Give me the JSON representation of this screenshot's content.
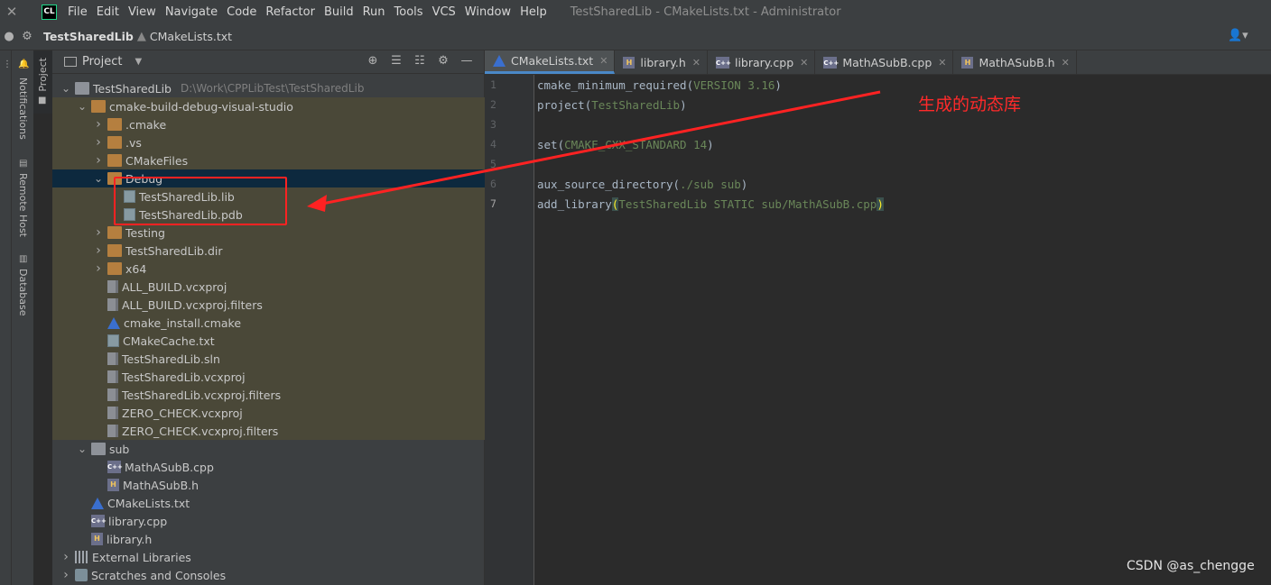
{
  "menubar": {
    "close_glyph": "✕",
    "logo": "CL",
    "items": [
      "File",
      "Edit",
      "View",
      "Navigate",
      "Code",
      "Refactor",
      "Build",
      "Run",
      "Tools",
      "VCS",
      "Window",
      "Help"
    ],
    "window_title": "TestSharedLib - CMakeLists.txt - Administrator"
  },
  "navbar": {
    "project": "TestSharedLib",
    "file": "CMakeLists.txt"
  },
  "strip": {
    "project": "Project",
    "notifications": "Notifications",
    "remote_host": "Remote Host",
    "database": "Database"
  },
  "project_panel": {
    "title": "Project",
    "tree": [
      {
        "label": "TestSharedLib",
        "hint": "D:\\Work\\CPPLibTest\\TestSharedLib",
        "icon": "folder-root",
        "chev": "down",
        "level": 0
      },
      {
        "label": "cmake-build-debug-visual-studio",
        "icon": "folder",
        "chev": "down",
        "level": 1,
        "bg": "olive"
      },
      {
        "label": ".cmake",
        "icon": "folder",
        "chev": "right",
        "level": 2,
        "bg": "olive"
      },
      {
        "label": ".vs",
        "icon": "folder",
        "chev": "right",
        "level": 2,
        "bg": "olive"
      },
      {
        "label": "CMakeFiles",
        "icon": "folder",
        "chev": "right",
        "level": 2,
        "bg": "olive"
      },
      {
        "label": "Debug",
        "icon": "folder",
        "chev": "down",
        "level": 2,
        "bg": "selected"
      },
      {
        "label": "TestSharedLib.lib",
        "icon": "lib",
        "chev": "none",
        "level": 3,
        "bg": "olive"
      },
      {
        "label": "TestSharedLib.pdb",
        "icon": "lib",
        "chev": "none",
        "level": 3,
        "bg": "olive"
      },
      {
        "label": "Testing",
        "icon": "folder",
        "chev": "right",
        "level": 2,
        "bg": "olive"
      },
      {
        "label": "TestSharedLib.dir",
        "icon": "folder",
        "chev": "right",
        "level": 2,
        "bg": "olive"
      },
      {
        "label": "x64",
        "icon": "folder",
        "chev": "right",
        "level": 2,
        "bg": "olive"
      },
      {
        "label": "ALL_BUILD.vcxproj",
        "icon": "file",
        "chev": "none",
        "level": 2,
        "bg": "olive"
      },
      {
        "label": "ALL_BUILD.vcxproj.filters",
        "icon": "file",
        "chev": "none",
        "level": 2,
        "bg": "olive"
      },
      {
        "label": "cmake_install.cmake",
        "icon": "cmake",
        "chev": "none",
        "level": 2,
        "bg": "olive"
      },
      {
        "label": "CMakeCache.txt",
        "icon": "lib",
        "chev": "none",
        "level": 2,
        "bg": "olive"
      },
      {
        "label": "TestSharedLib.sln",
        "icon": "file",
        "chev": "none",
        "level": 2,
        "bg": "olive"
      },
      {
        "label": "TestSharedLib.vcxproj",
        "icon": "file",
        "chev": "none",
        "level": 2,
        "bg": "olive"
      },
      {
        "label": "TestSharedLib.vcxproj.filters",
        "icon": "file",
        "chev": "none",
        "level": 2,
        "bg": "olive"
      },
      {
        "label": "ZERO_CHECK.vcxproj",
        "icon": "file",
        "chev": "none",
        "level": 2,
        "bg": "olive"
      },
      {
        "label": "ZERO_CHECK.vcxproj.filters",
        "icon": "file",
        "chev": "none",
        "level": 2,
        "bg": "olive"
      },
      {
        "label": "sub",
        "icon": "folder-grey",
        "chev": "down",
        "level": 1
      },
      {
        "label": "MathASubB.cpp",
        "icon": "cpp",
        "chev": "none",
        "level": 2
      },
      {
        "label": "MathASubB.h",
        "icon": "h",
        "chev": "none",
        "level": 2
      },
      {
        "label": "CMakeLists.txt",
        "icon": "cmake",
        "chev": "none",
        "level": 1
      },
      {
        "label": "library.cpp",
        "icon": "cpp",
        "chev": "none",
        "level": 1
      },
      {
        "label": "library.h",
        "icon": "h",
        "chev": "none",
        "level": 1
      },
      {
        "label": "External Libraries",
        "icon": "bars",
        "chev": "right",
        "level": 0
      },
      {
        "label": "Scratches and Consoles",
        "icon": "scratch",
        "chev": "right",
        "level": 0
      }
    ]
  },
  "tabs": [
    {
      "label": "CMakeLists.txt",
      "icon": "cmake",
      "active": true
    },
    {
      "label": "library.h",
      "icon": "h",
      "active": false
    },
    {
      "label": "library.cpp",
      "icon": "cpp",
      "active": false
    },
    {
      "label": "MathASubB.cpp",
      "icon": "cpp",
      "active": false
    },
    {
      "label": "MathASubB.h",
      "icon": "h",
      "active": false
    }
  ],
  "editor": {
    "line_numbers": [
      "1",
      "2",
      "3",
      "4",
      "5",
      "6",
      "7"
    ],
    "current_line": "7",
    "lines": [
      {
        "fn": "cmake_minimum_required",
        "args": "VERSION 3.16"
      },
      {
        "fn": "project",
        "args": "TestSharedLib"
      },
      {
        "fn": "",
        "args": ""
      },
      {
        "fn": "set",
        "args": "CMAKE_CXX_STANDARD 14"
      },
      {
        "fn": "",
        "args": ""
      },
      {
        "fn": "aux_source_directory",
        "args": "./sub sub"
      },
      {
        "fn": "add_library",
        "args": "TestSharedLib STATIC sub/MathASubB.cpp"
      }
    ]
  },
  "annotation": {
    "text": "生成的动态库",
    "color": "#ff2a2a"
  },
  "watermark": "CSDN @as_chengge"
}
